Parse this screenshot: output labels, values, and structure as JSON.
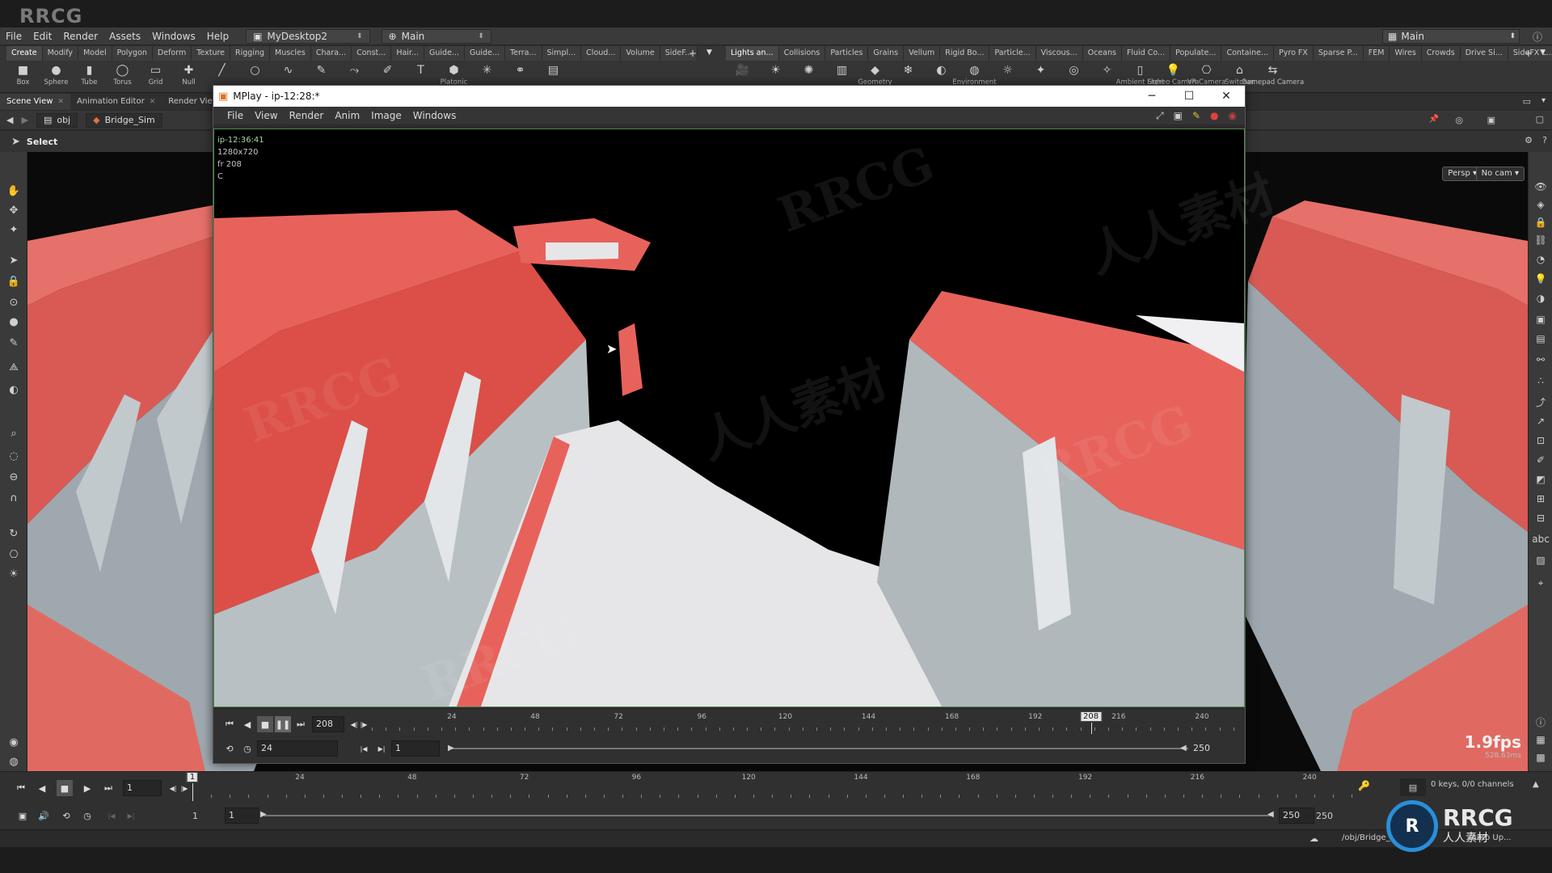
{
  "brand": "RRCG",
  "menubar": {
    "items": [
      "File",
      "Edit",
      "Render",
      "Assets",
      "Windows",
      "Help"
    ],
    "desktop": "MyDesktop2",
    "context": "Main",
    "right_context": "Main"
  },
  "shelf": {
    "tabs_left": [
      "Create",
      "Modify",
      "Model",
      "Polygon",
      "Deform",
      "Texture",
      "Rigging",
      "Muscles",
      "Chara...",
      "Const...",
      "Hair...",
      "Guide...",
      "Guide...",
      "Terra...",
      "Simpl...",
      "Cloud...",
      "Volume",
      "SideF..."
    ],
    "tabs_right": [
      "Lights an...",
      "Collisions",
      "Particles",
      "Grains",
      "Vellum",
      "Rigid Bo...",
      "Particle...",
      "Viscous...",
      "Oceans",
      "Fluid Co...",
      "Populate...",
      "Containe...",
      "Pyro FX",
      "Sparse P...",
      "FEM",
      "Wires",
      "Crowds",
      "Drive Si...",
      "SideFX L..."
    ],
    "tools_left": [
      {
        "label": "Box",
        "icon": "box-icon"
      },
      {
        "label": "Sphere",
        "icon": "sphere-icon"
      },
      {
        "label": "Tube",
        "icon": "tube-icon"
      },
      {
        "label": "Torus",
        "icon": "torus-icon"
      },
      {
        "label": "Grid",
        "icon": "grid-icon"
      },
      {
        "label": "Null",
        "icon": "null-icon"
      },
      {
        "label": "",
        "icon": "line-icon"
      },
      {
        "label": "",
        "icon": "circle-icon"
      },
      {
        "label": "",
        "icon": "curve-icon"
      },
      {
        "label": "",
        "icon": "draw-curve-icon"
      },
      {
        "label": "",
        "icon": "path-icon"
      },
      {
        "label": "",
        "icon": "spray-paint-icon"
      },
      {
        "label": "",
        "icon": "font-icon"
      },
      {
        "label": "Platonic",
        "icon": "platonic-icon"
      },
      {
        "label": "",
        "icon": "lsystem-icon"
      },
      {
        "label": "",
        "icon": "metaball-icon"
      },
      {
        "label": "",
        "icon": "file-icon"
      }
    ],
    "tools_right": [
      {
        "label": "",
        "icon": "camera-icon"
      },
      {
        "label": "",
        "icon": "point-light-icon"
      },
      {
        "label": "",
        "icon": "spot-light-icon"
      },
      {
        "label": "",
        "icon": "area-light-icon"
      },
      {
        "label": "Geometry",
        "icon": "geometry-light-icon"
      },
      {
        "label": "",
        "icon": "volume-light-icon"
      },
      {
        "label": "",
        "icon": "distant-light-icon"
      },
      {
        "label": "Environment",
        "icon": "environment-light-icon"
      },
      {
        "label": "",
        "icon": "sky-light-icon"
      },
      {
        "label": "",
        "icon": "gi-light-icon"
      },
      {
        "label": "",
        "icon": "caustic-light-icon"
      },
      {
        "label": "",
        "icon": "portal-light-icon"
      },
      {
        "label": "Ambient Light",
        "icon": "ambient-light-icon"
      },
      {
        "label": "Stereo Camera",
        "icon": "stereo-camera-icon"
      },
      {
        "label": "VR Camera",
        "icon": "vr-camera-icon"
      },
      {
        "label": "Switcher",
        "icon": "switcher-icon"
      },
      {
        "label": "Gamepad Camera",
        "icon": "gamepad-camera-icon"
      }
    ]
  },
  "panes": {
    "tabs": [
      "Scene View",
      "Animation Editor",
      "Render View"
    ],
    "path_root": "obj",
    "path_node": "Bridge_Sim",
    "tool_label": "Select",
    "persp_label": "Persp",
    "cam_label": "No cam"
  },
  "viewport": {
    "fps": "1.9fps",
    "frame_ms": "528.63ms"
  },
  "mplay": {
    "title": "MPlay - ip-12:28:*",
    "menu": [
      "File",
      "View",
      "Render",
      "Anim",
      "Image",
      "Windows"
    ],
    "info": [
      "ip-12:36:41",
      "1280x720",
      "fr 208",
      "C"
    ],
    "current_frame": "208",
    "fps_field": "24",
    "range_start": "1",
    "range_end": "250",
    "ticks": [
      "24",
      "48",
      "72",
      "96",
      "120",
      "144",
      "168",
      "192",
      "216",
      "240"
    ],
    "cursor_frame": 208
  },
  "timeline": {
    "current_frame": "1",
    "frame_marker": "1",
    "ticks": [
      "24",
      "48",
      "72",
      "96",
      "120",
      "144",
      "168",
      "192",
      "216",
      "240"
    ],
    "range_start": "1",
    "range_start2": "1",
    "range_end": "250",
    "range_end2": "250",
    "keys_status": "0 keys, 0/0 channels",
    "auto_update": "Auto Up..."
  },
  "statusbar": {
    "path": "/obj/Bridge_Sim"
  },
  "watermark": {
    "logo_text": "RRCG",
    "logo_sub": "人人素材"
  }
}
